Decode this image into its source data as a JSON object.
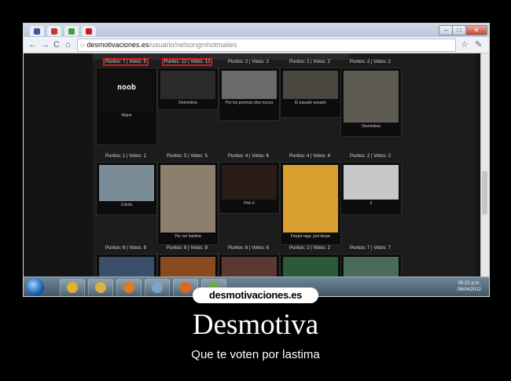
{
  "browser": {
    "tabs": [
      {
        "icon": "facebook-icon",
        "color": "#3b5998"
      },
      {
        "icon": "instagram-icon",
        "color": "#c0392b"
      },
      {
        "icon": "photos-icon",
        "color": "#4a9a3d"
      },
      {
        "icon": "youtube-icon",
        "color": "#cc181e"
      }
    ],
    "url_host": "desmotivaciones.es",
    "url_path": "/usuario/nelsongmhotmailes",
    "window_buttons": [
      "–",
      "□",
      "✕"
    ]
  },
  "page": {
    "header_strip": "",
    "rows": [
      [
        {
          "label": "Puntos: 7 | Votos: 5",
          "highlight": true,
          "caption": "Rique",
          "image_text": "noob",
          "bg": "#101010"
        },
        {
          "label": "Puntos: 12 | Votos: 12",
          "highlight": true,
          "caption": "Desmotiva",
          "image_text": "",
          "bg": "#2b2b2b"
        },
        {
          "label": "Puntos: 2 | Votos: 2",
          "highlight": false,
          "caption": "Por los poemas dice nunca",
          "image_text": "",
          "bg": "#6a6a6a"
        },
        {
          "label": "Puntos: 2 | Votos: 2",
          "highlight": false,
          "caption": "El pasado pesado",
          "image_text": "",
          "bg": "#4a4640"
        },
        {
          "label": "Puntos: 2 | Votos: 2",
          "highlight": false,
          "caption": "Desmotiva",
          "image_text": "",
          "bg": "#5e5b52"
        }
      ],
      [
        {
          "label": "Puntos: 1 | Votos: 1",
          "highlight": false,
          "caption": "Colofa",
          "image_text": "",
          "bg": "#7b8c99"
        },
        {
          "label": "Puntos: 5 | Votos: 5",
          "highlight": false,
          "caption": "Por ver lastima",
          "image_text": "",
          "bg": "#8d7e6d"
        },
        {
          "label": "Puntos: 4 | Votos: 6",
          "highlight": false,
          "caption": "Pick 6",
          "image_text": "",
          "bg": "#2a1d18"
        },
        {
          "label": "Puntos: 4 | Votos: 4",
          "highlight": false,
          "caption": "Forget rage, just derpe",
          "image_text": "",
          "bg": "#d9a030"
        },
        {
          "label": "Puntos: 2 | Votos: 2",
          "highlight": false,
          "caption": "2",
          "image_text": "",
          "bg": "#c8c8c8"
        }
      ],
      [
        {
          "label": "Puntos: 6 | Votos: 8",
          "highlight": false,
          "caption": "",
          "image_text": "",
          "bg": "#3a4f6a"
        },
        {
          "label": "Puntos: 8 | Votos: 8",
          "highlight": false,
          "caption": "",
          "image_text": "",
          "bg": "#8a4a20"
        },
        {
          "label": "Puntos: 6 | Votos: 6",
          "highlight": false,
          "caption": "",
          "image_text": "",
          "bg": "#5a3a30"
        },
        {
          "label": "Puntos: 2 | Votos: 2",
          "highlight": false,
          "caption": "",
          "image_text": "",
          "bg": "#2a5a3a"
        },
        {
          "label": "Puntos: 7 | Votos: 7",
          "highlight": false,
          "caption": "",
          "image_text": "",
          "bg": "#4a6a5a"
        }
      ]
    ]
  },
  "taskbar": {
    "apps": [
      {
        "icon": "chrome-icon",
        "color": "#e2b22a"
      },
      {
        "icon": "folder-icon",
        "color": "#d9b24a"
      },
      {
        "icon": "media-player-icon",
        "color": "#e07a1c"
      },
      {
        "icon": "media-center-icon",
        "color": "#7aa6c8"
      },
      {
        "icon": "firefox-icon",
        "color": "#e0661c"
      },
      {
        "icon": "network-icon",
        "color": "#6aa84f"
      }
    ],
    "clock_time": "05:22 p.m.",
    "clock_date": "06/04/2012"
  },
  "poster": {
    "logo": "desmotivaciones.es",
    "title": "Desmotiva",
    "subtitle": "Que te voten por lastima"
  }
}
